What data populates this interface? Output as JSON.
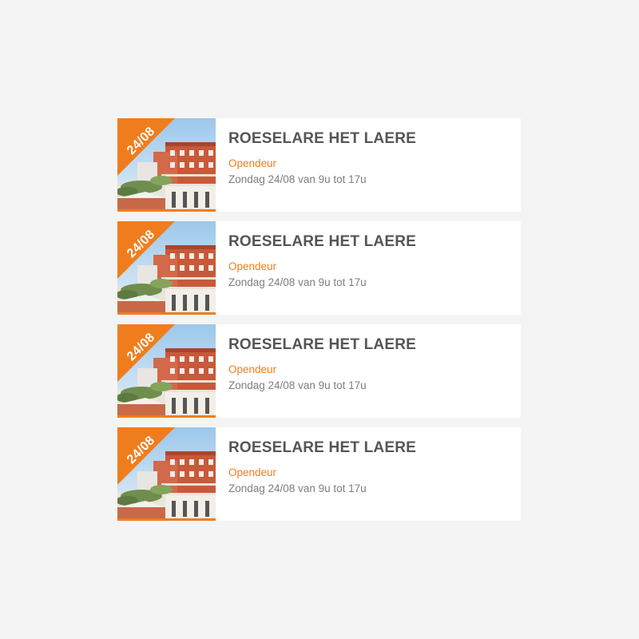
{
  "colors": {
    "accent": "#f07d1d",
    "title": "#555555",
    "muted": "#7d7d7d",
    "card_bg": "#ffffff",
    "page_bg": "#f4f4f4"
  },
  "events": [
    {
      "date_badge": "24/08",
      "title": "ROESELARE HET LAERE",
      "type": "Opendeur",
      "schedule": "Zondag 24/08 van 9u tot 17u",
      "image_icon": "building-rendering-image"
    },
    {
      "date_badge": "24/08",
      "title": "ROESELARE HET LAERE",
      "type": "Opendeur",
      "schedule": "Zondag 24/08 van 9u tot 17u",
      "image_icon": "building-rendering-image"
    },
    {
      "date_badge": "24/08",
      "title": "ROESELARE HET LAERE",
      "type": "Opendeur",
      "schedule": "Zondag 24/08 van 9u tot 17u",
      "image_icon": "building-rendering-image"
    },
    {
      "date_badge": "24/08",
      "title": "ROESELARE HET LAERE",
      "type": "Opendeur",
      "schedule": "Zondag 24/08 van 9u tot 17u",
      "image_icon": "building-rendering-image"
    }
  ]
}
